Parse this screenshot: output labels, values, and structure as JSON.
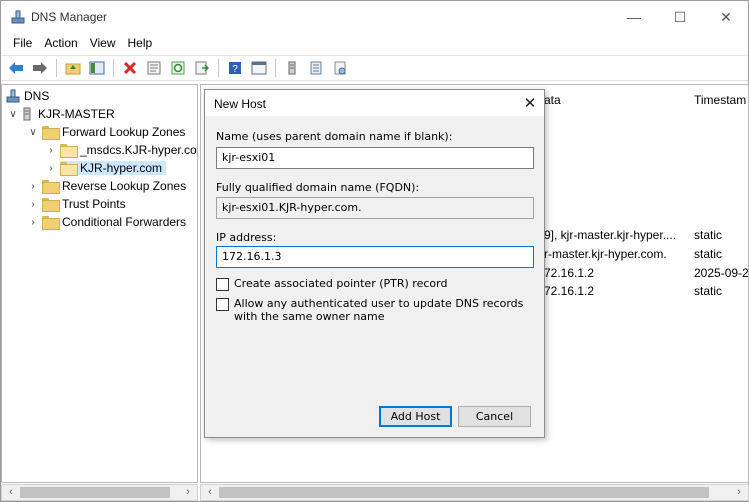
{
  "window": {
    "title": "DNS Manager",
    "minimize": "—",
    "maximize": "☐",
    "close": "✕"
  },
  "menu": [
    "File",
    "Action",
    "View",
    "Help"
  ],
  "toolbar_icons": [
    "back-icon",
    "forward-icon",
    "up-folder-icon",
    "show-hide-tree-icon",
    "delete-icon",
    "properties-icon",
    "refresh-icon",
    "export-list-icon",
    "help-icon",
    "console-icon",
    "server-icon",
    "zone-icon",
    "record-icon"
  ],
  "tree": {
    "root": "DNS",
    "server": "KJR-MASTER",
    "forward_zones": "Forward Lookup Zones",
    "msdcs_zone": "_msdcs.KJR-hyper.co",
    "kjr_zone": "KJR-hyper.com",
    "reverse_zones": "Reverse Lookup Zones",
    "trust_points": "Trust Points",
    "conditional_forwarders": "Conditional Forwarders"
  },
  "list": {
    "col_data": "ata",
    "col_timestamp": "Timestam",
    "rows": [
      {
        "data": "9], kjr-master.kjr-hyper....",
        "timestamp": "static"
      },
      {
        "data": "r-master.kjr-hyper.com.",
        "timestamp": "static"
      },
      {
        "data": "72.16.1.2",
        "timestamp": "2025-09-2("
      },
      {
        "data": "72.16.1.2",
        "timestamp": "static"
      }
    ]
  },
  "dialog": {
    "title": "New Host",
    "name_label": "Name (uses parent domain name if blank):",
    "name_value": "kjr-esxi01",
    "fqdn_label": "Fully qualified domain name (FQDN):",
    "fqdn_value": "kjr-esxi01.KJR-hyper.com.",
    "ip_label": "IP address:",
    "ip_value": "172.16.1.3",
    "ptr_label": "Create associated pointer (PTR) record",
    "ptr_checked": false,
    "auth_label": "Allow any authenticated user to update DNS records with the same owner name",
    "auth_checked": false,
    "add_button": "Add Host",
    "cancel_button": "Cancel"
  },
  "colors": {
    "accent": "#0078d7",
    "selection": "#cce8ff",
    "folder": "#f1cf73"
  }
}
